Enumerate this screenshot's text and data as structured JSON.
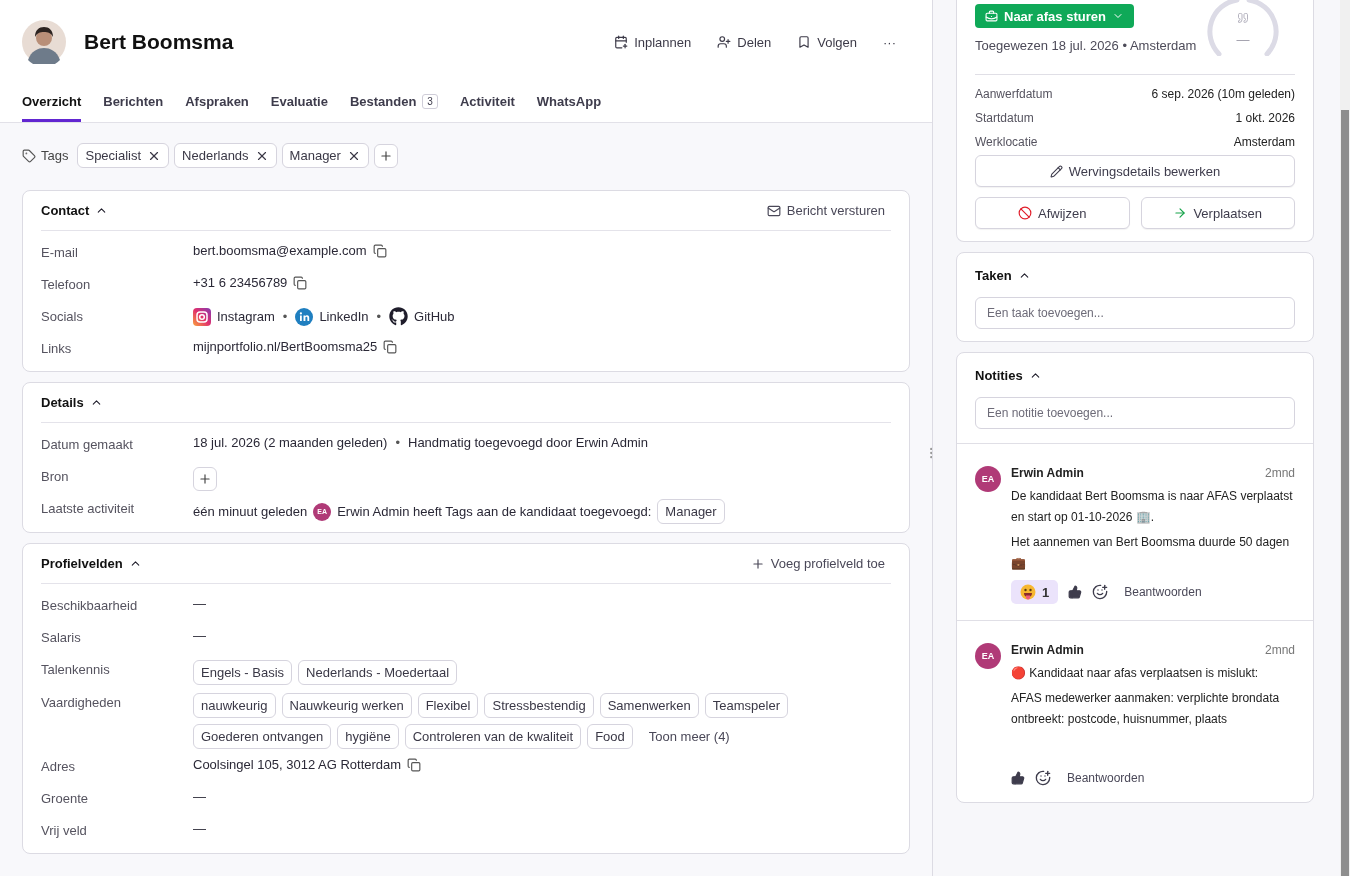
{
  "header": {
    "name": "Bert Boomsma",
    "actions": [
      {
        "label": "Inplannen"
      },
      {
        "label": "Delen"
      },
      {
        "label": "Volgen"
      },
      {
        "label": "···"
      }
    ]
  },
  "tabs": [
    {
      "label": "Overzicht",
      "selected": true
    },
    {
      "label": "Berichten",
      "selected": false
    },
    {
      "label": "Afspraken",
      "selected": false
    },
    {
      "label": "Evaluatie",
      "selected": false
    },
    {
      "label": "Bestanden",
      "count": "3",
      "selected": false
    },
    {
      "label": "Activiteit",
      "selected": false
    },
    {
      "label": "WhatsApp",
      "selected": false
    }
  ],
  "tags": {
    "label": "Tags",
    "items": [
      "Specialist",
      "Nederlands",
      "Manager"
    ]
  },
  "contact": {
    "title": "Contact",
    "expanded": true,
    "action": "Bericht versturen",
    "rows": [
      {
        "label": "E-mail",
        "kind": "copy",
        "value": "bert.boomsma@example.com"
      },
      {
        "label": "Telefoon",
        "kind": "copy",
        "value": "+31 6 23456789"
      },
      {
        "label": "Socials",
        "kind": "socials",
        "separator": "•",
        "items": [
          "Instagram",
          "LinkedIn",
          "GitHub"
        ]
      },
      {
        "label": "Links",
        "kind": "copy",
        "value": "mijnportfolio.nl/BertBoomsma25"
      }
    ]
  },
  "details": {
    "title": "Details",
    "expanded": true,
    "rows": [
      {
        "label": "Datum gemaakt",
        "kind": "text",
        "value": "18 jul. 2026 (2 maanden geleden)",
        "separator": "•",
        "extra": "Handmatig toegevoegd door Erwin Admin"
      },
      {
        "label": "Bron",
        "kind": "add"
      },
      {
        "label": "Laatste activiteit",
        "kind": "activity",
        "value": "één minuut geleden",
        "avatar": "EA",
        "text": "Erwin Admin heeft Tags aan de kandidaat toegevoegd:",
        "chip": "Manager"
      }
    ]
  },
  "profile": {
    "title": "Profielvelden",
    "expanded": true,
    "action": "Voeg profielveld toe",
    "rows": [
      {
        "label": "Beschikbaarheid",
        "kind": "text",
        "value": "—"
      },
      {
        "label": "Salaris",
        "kind": "text",
        "value": "—"
      },
      {
        "label": "Talenkennis",
        "kind": "chips",
        "items": [
          "Engels - Basis",
          "Nederlands - Moedertaal"
        ]
      },
      {
        "label": "Vaardigheden",
        "kind": "chips",
        "items": [
          "nauwkeurig",
          "Nauwkeurig werken",
          "Flexibel",
          "Stressbestendig",
          "Samenwerken",
          "Teamspeler",
          "Goederen ontvangen",
          "hygiëne",
          "Controleren van de kwaliteit",
          "Food"
        ],
        "more": "Toon meer (4)"
      },
      {
        "label": "Adres",
        "kind": "copy",
        "value": "Coolsingel 105, 3012 AG Rotterdam"
      },
      {
        "label": "Groente",
        "kind": "text",
        "value": "—"
      },
      {
        "label": "Vrij veld",
        "kind": "text",
        "value": "—"
      }
    ]
  },
  "hiring": {
    "button": "Naar afas sturen",
    "assigned": "Toegewezen 18 jul. 2026 • Amsterdam",
    "gauge": "—",
    "fields": [
      {
        "label": "Aanwerfdatum",
        "value": "6 sep. 2026 (10m geleden)"
      },
      {
        "label": "Startdatum",
        "value": "1 okt. 2026"
      },
      {
        "label": "Werklocatie",
        "value": "Amsterdam"
      }
    ],
    "edit": "Wervingsdetails bewerken",
    "reject": "Afwijzen",
    "move": "Verplaatsen"
  },
  "tasks": {
    "title": "Taken",
    "expanded": true,
    "placeholder": "Een taak toevoegen..."
  },
  "notes": {
    "title": "Notities",
    "expanded": true,
    "placeholder": "Een notitie toevoegen...",
    "items": [
      {
        "avatar": "EA",
        "author": "Erwin Admin",
        "time": "2mnd",
        "paragraphs": [
          "De kandidaat Bert Boomsma is naar AFAS verplaatst en start op 01-10-2026 🏢.",
          "Het aannemen van Bert Boomsma duurde 50 dagen 💼"
        ],
        "reactions": [
          {
            "count": "1",
            "selected": true
          }
        ],
        "reply": "Beantwoorden"
      },
      {
        "avatar": "EA",
        "author": "Erwin Admin",
        "time": "2mnd",
        "paragraphs": [
          "🔴 Kandidaat naar afas verplaatsen is mislukt:",
          "AFAS medewerker aanmaken: verplichte brondata ontbreekt: postcode, huisnummer, plaats"
        ],
        "reply": "Beantwoorden"
      }
    ]
  }
}
